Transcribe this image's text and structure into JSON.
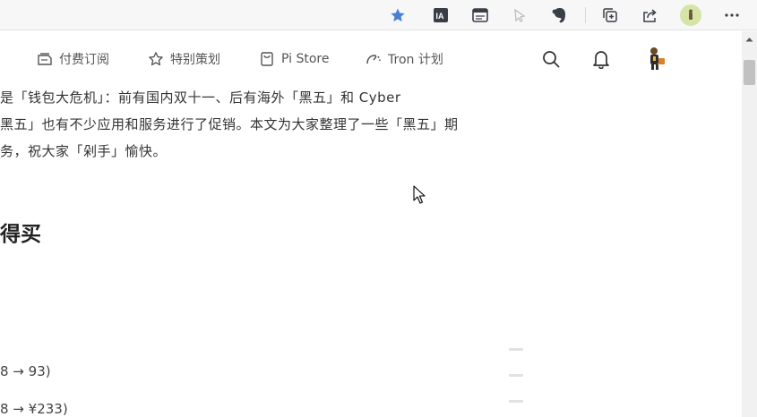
{
  "browser": {
    "icons": [
      "favorite-star-icon",
      "immersive-reader-icon",
      "reading-view-icon",
      "read-aloud-icon",
      "evernote-icon",
      "collections-icon",
      "share-icon",
      "profile-avatar",
      "more-icon"
    ],
    "accent_color": "#4a7fd4"
  },
  "nav": {
    "items": [
      {
        "label": "付费订阅",
        "icon": "subscription-icon"
      },
      {
        "label": "特别策划",
        "icon": "star-outline-icon"
      },
      {
        "label": "Pi Store",
        "icon": "bag-icon"
      },
      {
        "label": "Tron 计划",
        "icon": "arc-icon"
      }
    ],
    "right_icons": [
      "search-icon",
      "bell-icon",
      "user-avatar"
    ]
  },
  "article": {
    "intro_lines": [
      "是「钱包大危机」：前有国内双十一、后有海外「黑五」和 Cyber",
      "黑五」也有不少应用和服务进行了促销。本文为大家整理了一些「黑五」期",
      "务，祝大家「剁手」愉快。"
    ],
    "section_heading": "得买",
    "price_lines": [
      "8 → 93)",
      "8 → ¥233)"
    ]
  }
}
